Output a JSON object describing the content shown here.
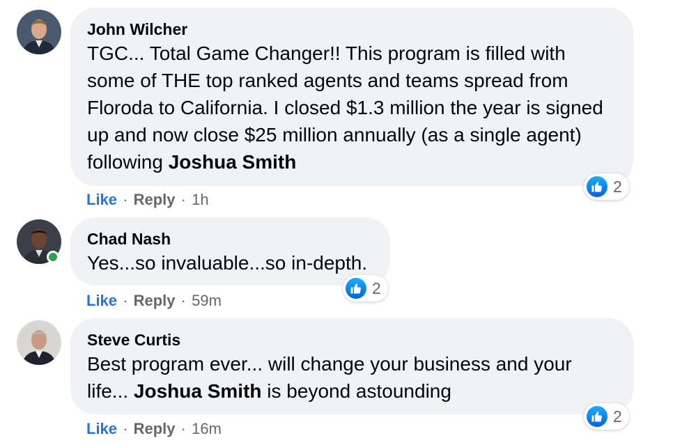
{
  "comments": [
    {
      "author": "John Wilcher",
      "text_before": "TGC... Total Game Changer!! This program is filled with some of THE top ranked agents and teams spread from Floroda to California. I closed $1.3 million the year is signed up and now close $25 million annually (as a single agent) following ",
      "mention": "Joshua Smith",
      "text_after": "",
      "like_label": "Like",
      "reply_label": "Reply",
      "separator": "·",
      "time": "1h",
      "reactions": {
        "icon": "like-icon",
        "count": "2"
      },
      "online": false
    },
    {
      "author": "Chad Nash",
      "text_before": "Yes...so invaluable...so in-depth.",
      "mention": "",
      "text_after": "",
      "like_label": "Like",
      "reply_label": "Reply",
      "separator": "·",
      "time": "59m",
      "reactions": {
        "icon": "like-icon",
        "count": "2"
      },
      "online": true
    },
    {
      "author": "Steve Curtis",
      "text_before": "Best program ever... will change your business and your life... ",
      "mention": "Joshua Smith",
      "text_after": " is beyond astounding",
      "like_label": "Like",
      "reply_label": "Reply",
      "separator": "·",
      "time": "16m",
      "reactions": {
        "icon": "like-icon",
        "count": "2"
      },
      "online": false
    }
  ],
  "colors": {
    "bubble": "#f0f2f5",
    "like_link": "#2374e1",
    "meta_text": "#65676b",
    "online": "#31a24c",
    "reaction_blue": "#1877f2"
  }
}
